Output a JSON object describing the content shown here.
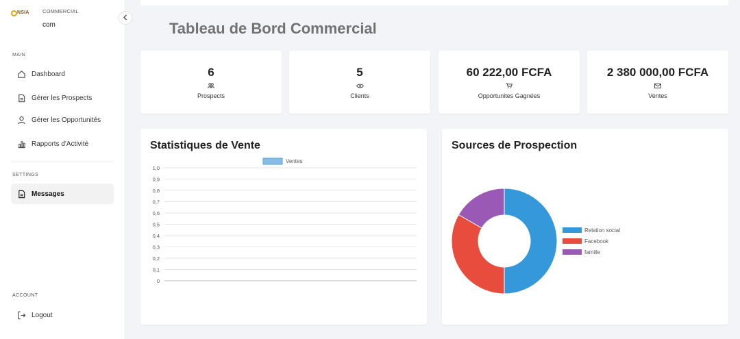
{
  "brand": {
    "logo_text": "NSIA",
    "role": "COMMERCIAL",
    "user": "com"
  },
  "sidebar": {
    "main_label": "MAIN",
    "items": [
      {
        "label": "Dashboard",
        "icon": "home-icon"
      },
      {
        "label": "Gérer les Prospects",
        "icon": "document-icon"
      },
      {
        "label": "Gérer les Opportunités",
        "icon": "user-icon"
      },
      {
        "label": "Rapports d'Activité",
        "icon": "bar-chart-icon"
      }
    ],
    "settings_label": "SETTINGS",
    "messages_label": "Messages",
    "account_label": "ACCOUNT",
    "logout_label": "Logout"
  },
  "page": {
    "title": "Tableau de Bord Commercial"
  },
  "stats": [
    {
      "value": "6",
      "label": "Prospects",
      "icon": "users-icon"
    },
    {
      "value": "5",
      "label": "Clients",
      "icon": "eye-icon"
    },
    {
      "value": "60 222,00 FCFA",
      "label": "Opportunites Gagnées",
      "icon": "cart-icon"
    },
    {
      "value": "2 380 000,00 FCFA",
      "label": "Ventes",
      "icon": "mail-icon"
    }
  ],
  "sales_chart": {
    "title": "Statistiques de Vente",
    "legend": "Ventes",
    "color": "#86bde6",
    "chart_data": {
      "type": "bar",
      "categories": [],
      "series": [
        {
          "name": "Ventes",
          "values": []
        }
      ],
      "yticks": [
        "1,0",
        "0,9",
        "0,8",
        "0,7",
        "0,6",
        "0,5",
        "0,4",
        "0,3",
        "0,2",
        "0,1",
        "0"
      ],
      "ylim": [
        0,
        1
      ],
      "legend_position": "top"
    }
  },
  "source_chart": {
    "title": "Sources de Prospection",
    "chart_data": {
      "type": "pie",
      "donut": true,
      "labels": [
        "Relation social",
        "Facebook",
        "famille"
      ],
      "values": [
        3,
        2,
        1
      ],
      "colors": [
        "#3498db",
        "#e74c3c",
        "#9b59b6"
      ],
      "legend_position": "right"
    }
  }
}
